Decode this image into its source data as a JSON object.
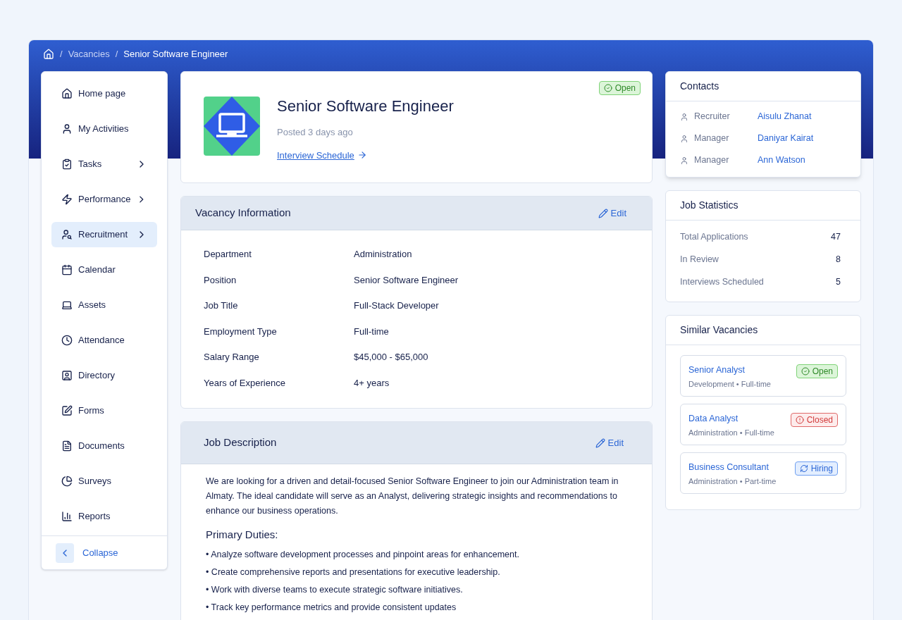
{
  "breadcrumb": [
    {
      "separator": "/",
      "label": "Vacancies"
    },
    {
      "separator": "/",
      "label": "Senior Software Engineer"
    }
  ],
  "sidebar": {
    "items": [
      {
        "label": "Home page",
        "submenu": false,
        "selected": false
      },
      {
        "label": "My Activities",
        "submenu": false,
        "selected": false
      },
      {
        "label": "Tasks",
        "submenu": true,
        "selected": false
      },
      {
        "label": "Performance",
        "submenu": true,
        "selected": false
      },
      {
        "label": "Recruitment",
        "submenu": true,
        "selected": true
      },
      {
        "label": "Calendar",
        "submenu": false,
        "selected": false
      },
      {
        "label": "Assets",
        "submenu": false,
        "selected": false
      },
      {
        "label": "Attendance",
        "submenu": false,
        "selected": false
      },
      {
        "label": "Directory",
        "submenu": false,
        "selected": false
      },
      {
        "label": "Forms",
        "submenu": false,
        "selected": false
      },
      {
        "label": "Documents",
        "submenu": false,
        "selected": false
      },
      {
        "label": "Surveys",
        "submenu": false,
        "selected": false
      },
      {
        "label": "Reports",
        "submenu": false,
        "selected": false
      }
    ],
    "collapse": "Collapse"
  },
  "header": {
    "title": "Senior Software Engineer",
    "posted": "Posted 3 days ago",
    "link": "Interview Schedule",
    "status": {
      "kind": "open",
      "label": "Open"
    }
  },
  "vacancy_info": {
    "title": "Vacancy Information",
    "edit": "Edit",
    "rows": [
      {
        "label": "Department",
        "value": "Administration"
      },
      {
        "label": "Position",
        "value": "Senior Software Engineer"
      },
      {
        "label": "Job Title",
        "value": "Full-Stack Developer"
      },
      {
        "label": "Employment Type",
        "value": "Full-time"
      },
      {
        "label": "Salary Range",
        "value": "$45,000 - $65,000"
      },
      {
        "label": "Years of Experience",
        "value": "4+ years"
      }
    ]
  },
  "job_description": {
    "title": "Job Description",
    "edit": "Edit",
    "intro": "We are looking for a driven and detail-focused Senior Software Engineer to join our Administration team in Almaty. The ideal candidate will serve as an Analyst, delivering strategic insights and recommendations to enhance our business operations.",
    "duties_title": "Primary Duties:",
    "duties": [
      "• Analyze software development processes and pinpoint areas for enhancement.",
      "• Create comprehensive reports and presentations for executive leadership.",
      "• Work with diverse teams to execute strategic software initiatives.",
      "• Track key performance metrics and provide consistent updates"
    ]
  },
  "contacts": {
    "title": "Contacts",
    "items": [
      {
        "role": "Recruiter",
        "name": "Aisulu Zhanat"
      },
      {
        "role": "Manager",
        "name": "Daniyar Kairat"
      },
      {
        "role": "Manager",
        "name": "Ann Watson"
      }
    ]
  },
  "job_statistics": {
    "title": "Job Statistics",
    "items": [
      {
        "label": "Total Applications",
        "value": "47"
      },
      {
        "label": "In Review",
        "value": "8"
      },
      {
        "label": "Interviews Scheduled",
        "value": "5"
      }
    ]
  },
  "similar_vacancies": {
    "title": "Similar Vacancies",
    "items": [
      {
        "title": "Senior Analyst",
        "meta": "Development • Full-time",
        "status": {
          "kind": "open",
          "label": "Open"
        }
      },
      {
        "title": "Data Analyst",
        "meta": "Administration • Full-time",
        "status": {
          "kind": "closed",
          "label": "Closed"
        }
      },
      {
        "title": "Business Consultant",
        "meta": "Administration • Part-time",
        "status": {
          "kind": "hiring",
          "label": "Hiring"
        }
      }
    ]
  }
}
